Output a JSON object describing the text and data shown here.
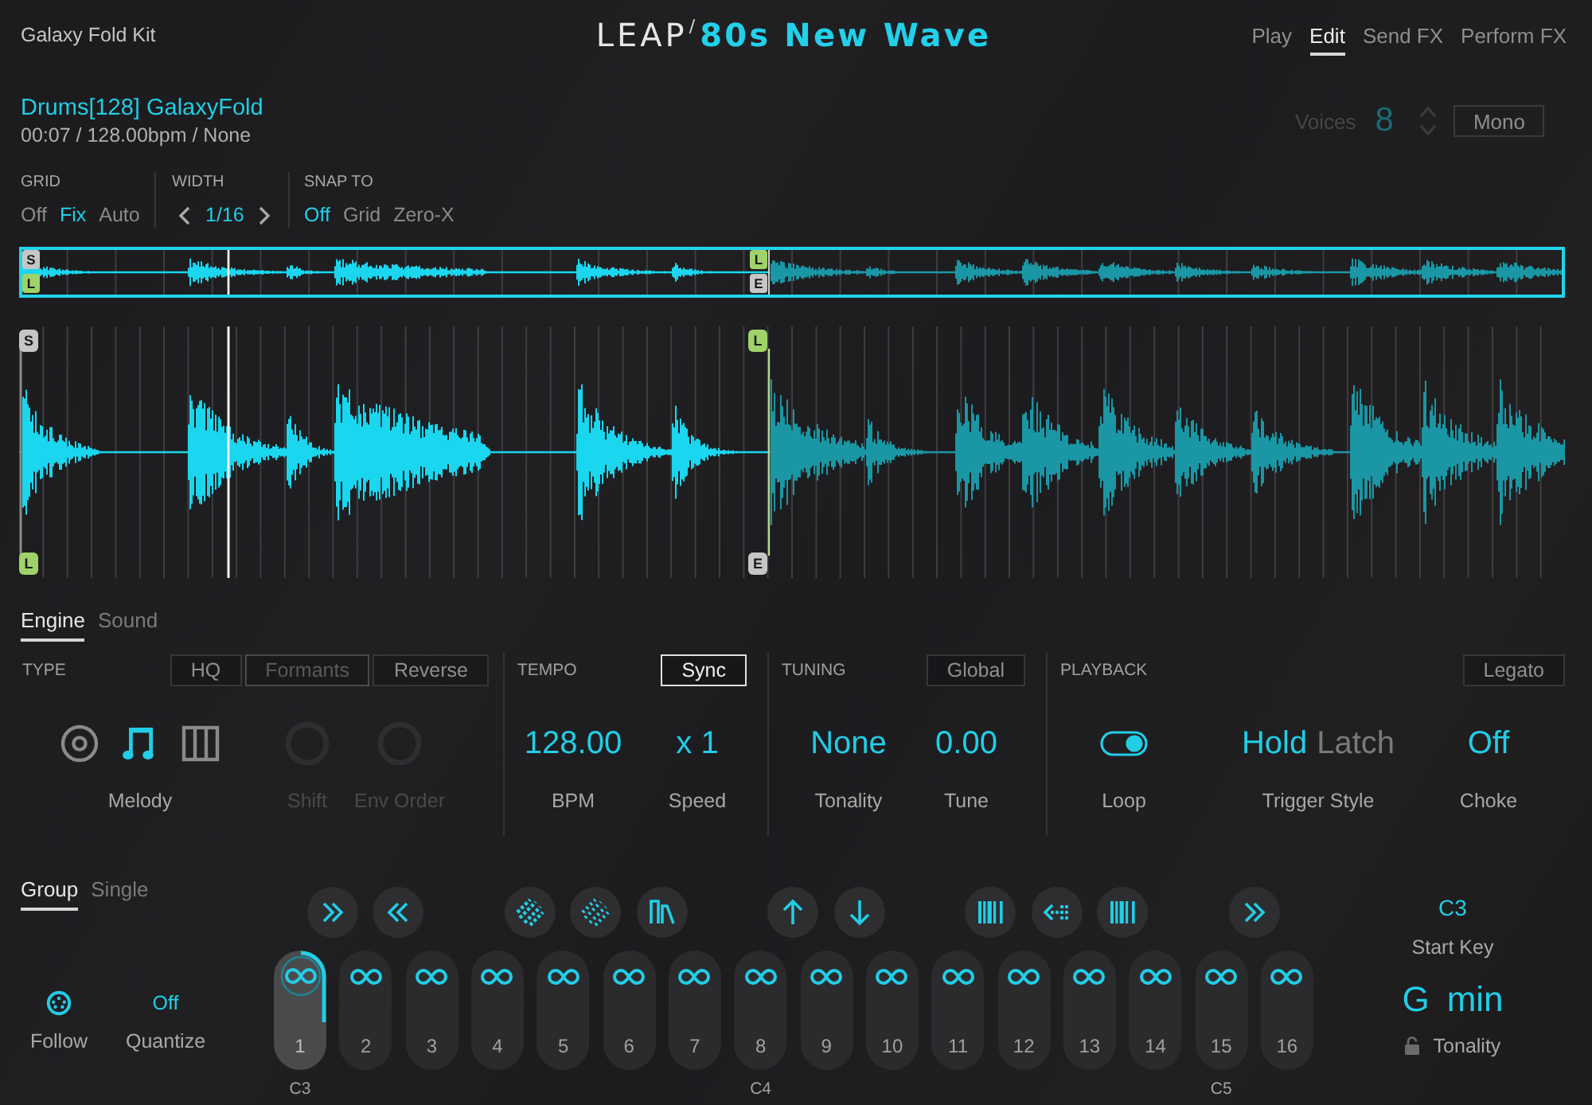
{
  "header": {
    "kit_name": "Galaxy Fold Kit",
    "logo": {
      "brand": "LEAP",
      "mark": "/",
      "title": "80s New Wave"
    },
    "nav": [
      {
        "label": "Play",
        "selected": false
      },
      {
        "label": "Edit",
        "selected": true
      },
      {
        "label": "Send FX",
        "selected": false
      },
      {
        "label": "Perform FX",
        "selected": false
      }
    ]
  },
  "sample": {
    "name": "Drums[128] GalaxyFold",
    "info": "00:07 / 128.00bpm / None"
  },
  "voices": {
    "label": "Voices",
    "value": "8",
    "disabled": true,
    "mono": {
      "label": "Mono",
      "on": false
    }
  },
  "grid_controls": [
    {
      "kind": "options",
      "label": "GRID",
      "options": [
        {
          "label": "Off",
          "selected": false
        },
        {
          "label": "Fix",
          "selected": true
        },
        {
          "label": "Auto",
          "selected": false
        }
      ]
    },
    {
      "kind": "stepper",
      "label": "WIDTH",
      "value": "1/16"
    },
    {
      "kind": "options",
      "label": "SNAP TO",
      "options": [
        {
          "label": "Off",
          "selected": true
        },
        {
          "label": "Grid",
          "selected": false
        },
        {
          "label": "Zero-X",
          "selected": false
        }
      ]
    }
  ],
  "overview": {
    "marker_groups": [
      {
        "markers": [
          {
            "label": "S",
            "kind": "sample"
          },
          {
            "label": "L",
            "kind": "loop"
          }
        ]
      },
      {
        "markers": [
          {
            "label": "L",
            "kind": "loop"
          },
          {
            "label": "E",
            "kind": "sample"
          }
        ]
      }
    ]
  },
  "waveform": {
    "marker_groups": [
      {
        "markers": [
          {
            "label": "S",
            "kind": "sample"
          },
          {
            "label": "L",
            "kind": "loop"
          }
        ]
      },
      {
        "markers": [
          {
            "label": "L",
            "kind": "loop"
          },
          {
            "label": "E",
            "kind": "sample"
          }
        ]
      }
    ]
  },
  "engine": {
    "tabs": [
      {
        "label": "Engine",
        "selected": true
      },
      {
        "label": "Sound",
        "selected": false
      }
    ],
    "sections": [
      {
        "kind": "type",
        "label": "TYPE",
        "buttons": [
          {
            "label": "HQ",
            "on": false,
            "disabled": false
          },
          {
            "label": "Formants",
            "on": false,
            "disabled": true
          },
          {
            "label": "Reverse",
            "on": false,
            "disabled": false
          }
        ],
        "params": [
          {
            "kind": "modes",
            "label": "Melody",
            "modes": [
              {
                "selected": false
              },
              {
                "selected": true
              },
              {
                "selected": false
              }
            ]
          },
          {
            "kind": "knob",
            "label": "Shift",
            "disabled": true
          },
          {
            "kind": "knob",
            "label": "Env Order",
            "disabled": true
          }
        ]
      },
      {
        "kind": "tempo",
        "label": "TEMPO",
        "buttons": [
          {
            "label": "Sync",
            "on": true,
            "disabled": false
          }
        ],
        "params": [
          {
            "kind": "value",
            "value": "128.00",
            "label": "BPM"
          },
          {
            "kind": "value",
            "value": "x 1",
            "label": "Speed"
          }
        ]
      },
      {
        "kind": "tuning",
        "label": "TUNING",
        "buttons": [
          {
            "label": "Global",
            "on": false,
            "disabled": false
          }
        ],
        "params": [
          {
            "kind": "value",
            "value": "None",
            "label": "Tonality"
          },
          {
            "kind": "value",
            "value": "0.00",
            "label": "Tune"
          }
        ]
      },
      {
        "kind": "playback",
        "label": "PLAYBACK",
        "buttons": [
          {
            "label": "Legato",
            "on": false,
            "disabled": false
          }
        ],
        "params": [
          {
            "kind": "toggle",
            "label": "Loop",
            "on": true
          },
          {
            "kind": "choice",
            "label": "Trigger Style",
            "options": [
              {
                "label": "Hold",
                "selected": true
              },
              {
                "label": "Latch",
                "selected": false
              }
            ]
          },
          {
            "kind": "value",
            "value": "Off",
            "label": "Choke"
          }
        ]
      }
    ]
  },
  "pads_panel": {
    "tabs": [
      {
        "label": "Group",
        "selected": true
      },
      {
        "label": "Single",
        "selected": false
      }
    ],
    "follow": {
      "label": "Follow",
      "on": true
    },
    "quantize": {
      "value": "Off",
      "label": "Quantize"
    },
    "pads": [
      {
        "label": "1",
        "selected": true,
        "note": "C3"
      },
      {
        "label": "2",
        "selected": false
      },
      {
        "label": "3",
        "selected": false
      },
      {
        "label": "4",
        "selected": false
      },
      {
        "label": "5",
        "selected": false
      },
      {
        "label": "6",
        "selected": false
      },
      {
        "label": "7",
        "selected": false
      },
      {
        "label": "8",
        "selected": false,
        "note": "C4"
      },
      {
        "label": "9",
        "selected": false
      },
      {
        "label": "10",
        "selected": false
      },
      {
        "label": "11",
        "selected": false
      },
      {
        "label": "12",
        "selected": false
      },
      {
        "label": "13",
        "selected": false
      },
      {
        "label": "14",
        "selected": false
      },
      {
        "label": "15",
        "selected": false,
        "note": "C5"
      },
      {
        "label": "16",
        "selected": false
      }
    ],
    "start_key": {
      "value": "C3",
      "label": "Start Key"
    },
    "tonality": {
      "root": "G",
      "scale": "min",
      "label": "Tonality",
      "locked": false
    }
  }
}
